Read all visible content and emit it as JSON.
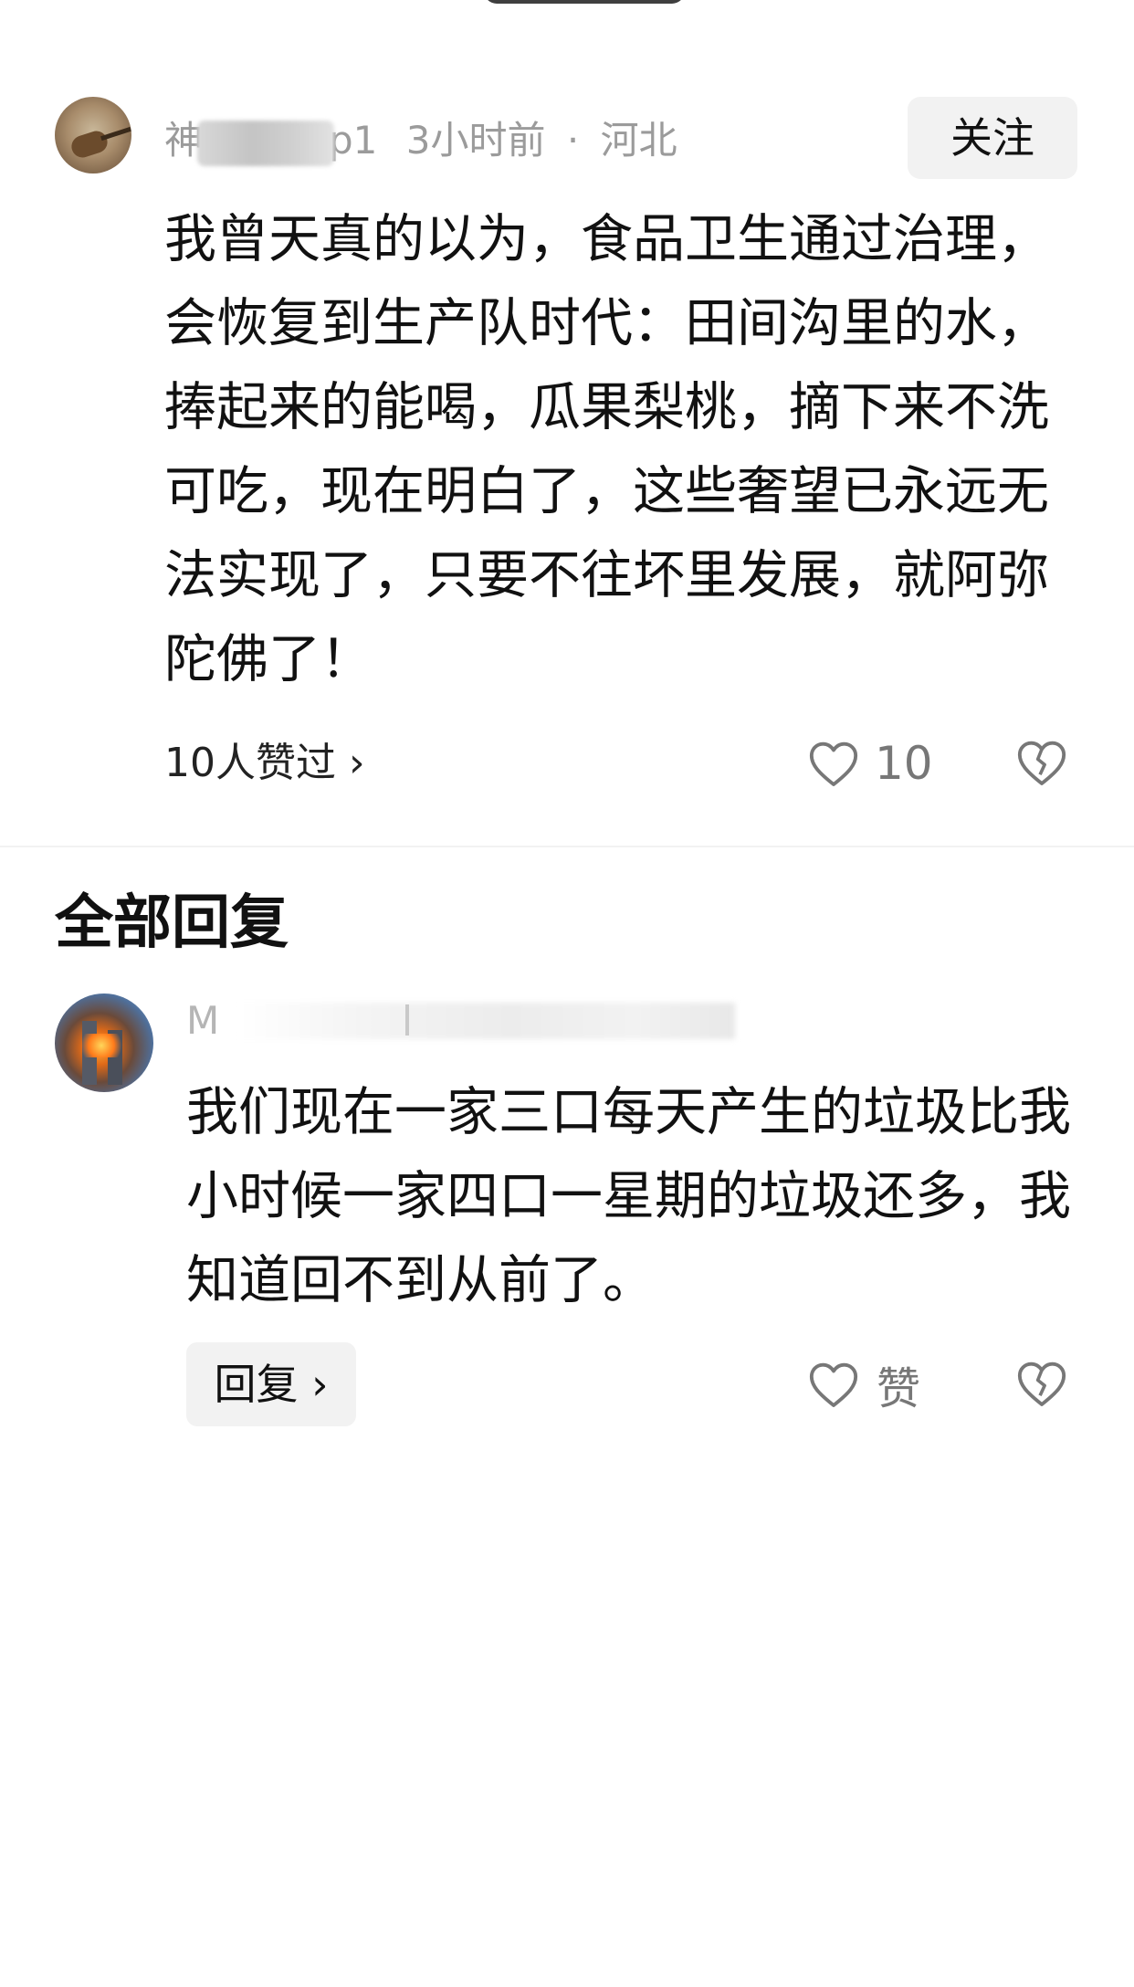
{
  "comment": {
    "author_visible_start": "神",
    "author_visible_end": "p1",
    "time": "3小时前",
    "separator": "·",
    "location": "河北",
    "follow_label": "关注",
    "text": "我曾天真的以为，食品卫生通过治理，会恢复到生产队时代：田间沟里的水，捧起来的能喝，瓜果梨桃，摘下来不洗可吃，现在明白了，这些奢望已永远无法实现了，只要不往坏里发展，就阿弥陀佛了！",
    "liked_by": "10人赞过 ›",
    "like_count": "10"
  },
  "replies_section": {
    "title": "全部回复"
  },
  "reply": {
    "author_visible": "M",
    "text": "我们现在一家三口每天产生的垃圾比我小时候一家四口一星期的垃圾还多，我知道回不到从前了。",
    "reply_label": "回复 ›",
    "like_label": "赞"
  },
  "icons": {
    "like": "heart-outline-icon",
    "dislike": "broken-heart-icon"
  },
  "colors": {
    "text": "#111111",
    "meta": "#9b9b9b",
    "button_bg": "#f2f2f2",
    "icon": "#777777"
  }
}
